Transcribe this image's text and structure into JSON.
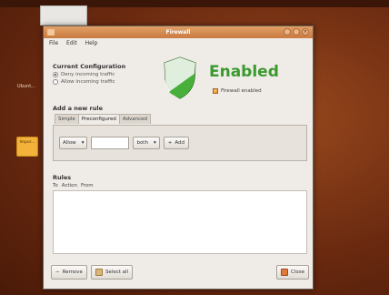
{
  "window": {
    "title": "Firewall"
  },
  "menu": [
    "File",
    "Edit",
    "Help"
  ],
  "config": {
    "title": "Current Configuration",
    "options": [
      "Deny incoming traffic",
      "Allow incoming traffic"
    ],
    "selected_index": 0
  },
  "status": {
    "label": "Enabled",
    "checkbox_label": "Firewall enabled",
    "checked": true,
    "color": "#3a9a2e"
  },
  "add_rule": {
    "title": "Add a new rule",
    "tabs": [
      "Simple",
      "Preconfigured",
      "Advanced"
    ],
    "active_tab": 1,
    "action_value": "Allow",
    "direction_value": "both",
    "port_value": "",
    "add_label": "Add"
  },
  "rules": {
    "title": "Rules",
    "columns": [
      "To",
      "Action",
      "From"
    ]
  },
  "buttons": {
    "remove": "Remove",
    "select_all": "Select all",
    "close": "Close"
  },
  "desktop": {
    "side_text": "Ubunt...",
    "icon_text": "Impor..."
  }
}
